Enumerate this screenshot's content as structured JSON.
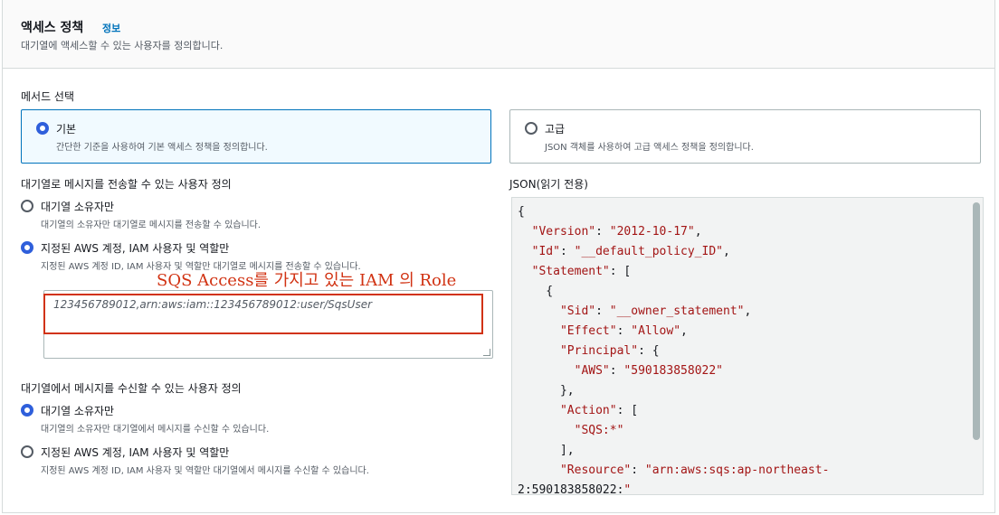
{
  "header": {
    "title": "액세스 정책",
    "info_link": "정보",
    "description": "대기열에 액세스할 수 있는 사용자를 정의합니다."
  },
  "method": {
    "label": "메서드 선택",
    "options": [
      {
        "title": "기본",
        "description": "간단한 기준을 사용하여 기본 액세스 정책을 정의합니다.",
        "selected": true
      },
      {
        "title": "고급",
        "description": "JSON 객체를 사용하여 고급 액세스 정책을 정의합니다.",
        "selected": false
      }
    ]
  },
  "send": {
    "label": "대기열로 메시지를 전송할 수 있는 사용자 정의",
    "options": [
      {
        "title": "대기열 소유자만",
        "description": "대기열의 소유자만 대기열로 메시지를 전송할 수 있습니다.",
        "selected": false
      },
      {
        "title": "지정된 AWS 계정, IAM 사용자 및 역할만",
        "description": "지정된 AWS 계정 ID, IAM 사용자 및 역할만 대기열로 메시지를 전송할 수 있습니다.",
        "selected": true
      }
    ],
    "principals_value": "123456789012,arn:aws:iam::123456789012:user/SqsUser"
  },
  "annotation": {
    "text": "SQS Access를 가지고 있는 IAM 의 Role",
    "color": "#d13212"
  },
  "receive": {
    "label": "대기열에서 메시지를 수신할 수 있는 사용자 정의",
    "options": [
      {
        "title": "대기열 소유자만",
        "description": "대기열의 소유자만 대기열에서 메시지를 수신할 수 있습니다.",
        "selected": true
      },
      {
        "title": "지정된 AWS 계정, IAM 사용자 및 역할만",
        "description": "지정된 AWS 계정 ID, IAM 사용자 및 역할만 대기열에서 메시지를 수신할 수 있습니다.",
        "selected": false
      }
    ]
  },
  "json_view": {
    "label": "JSON(읽기 전용)",
    "lines": [
      "{",
      "  \"Version\": \"2012-10-17\",",
      "  \"Id\": \"__default_policy_ID\",",
      "  \"Statement\": [",
      "    {",
      "      \"Sid\": \"__owner_statement\",",
      "      \"Effect\": \"Allow\",",
      "      \"Principal\": {",
      "        \"AWS\": \"590183858022\"",
      "      },",
      "      \"Action\": [",
      "        \"SQS:*\"",
      "      ],",
      "      \"Resource\": \"arn:aws:sqs:ap-northeast-",
      "2:590183858022:\""
    ]
  },
  "colors": {
    "accent": "#2f5fdb",
    "link": "#0073bb",
    "selected_tile_bg": "#f1faff",
    "json_key": "#a31515"
  }
}
